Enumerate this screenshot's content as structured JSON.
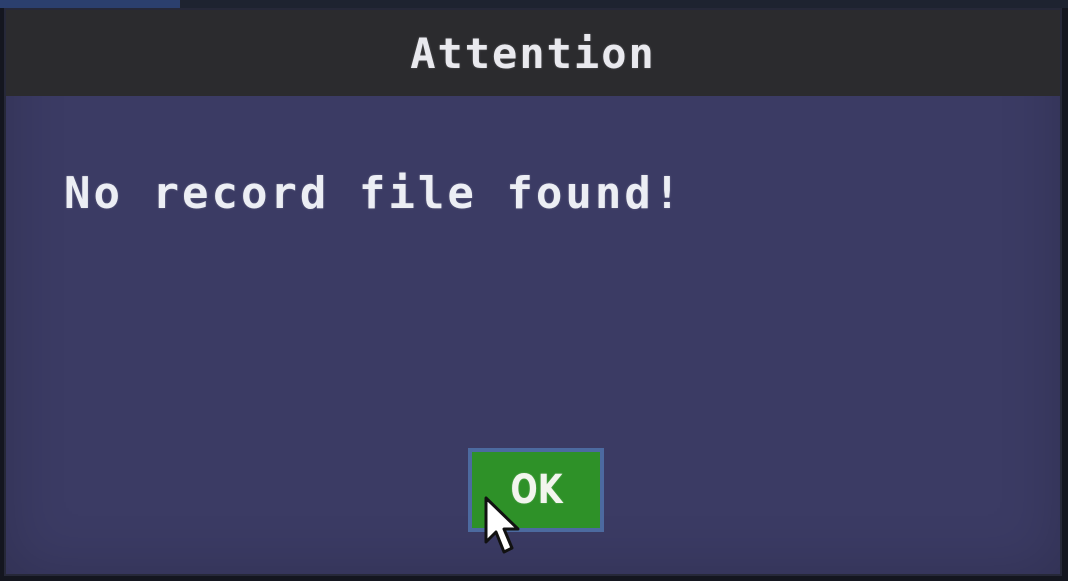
{
  "dialog": {
    "title": "Attention",
    "message": "No record file found!",
    "ok_label": "OK"
  },
  "cursor": {
    "icon": "mouse-pointer-icon"
  },
  "colors": {
    "dialog_body": "#3b3b64",
    "title_bar": "#2b2b2e",
    "ok_button": "#2e9128",
    "ok_button_border": "#4c6aa0",
    "text": "#e9e9ee"
  }
}
